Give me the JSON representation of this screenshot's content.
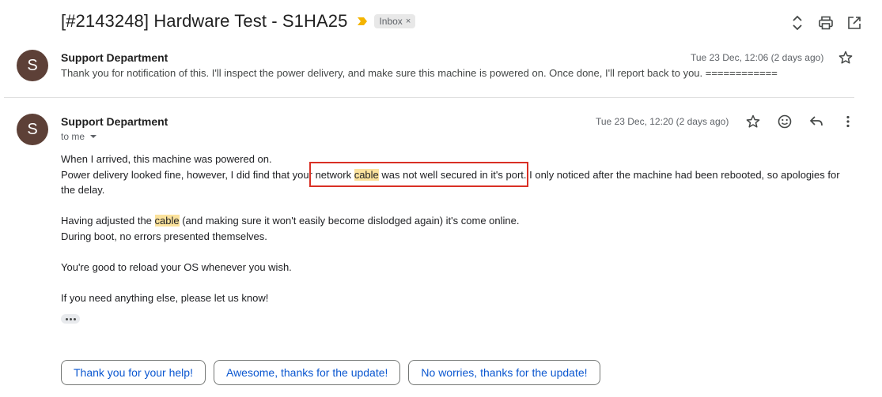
{
  "subject": "[#2143248] Hardware Test - S1HA25",
  "label": "Inbox",
  "label_remove": "×",
  "toolbar": {
    "expand_icon": "unfold-icon",
    "print_icon": "print-icon",
    "open_new_window_icon": "open-in-new-icon"
  },
  "messages": [
    {
      "avatar_letter": "S",
      "sender": "Support Department",
      "snippet": "Thank you for notification of this. I'll inspect the power delivery, and make sure this machine is powered on. Once done, I'll report back to you. ============",
      "date": "Tue 23 Dec, 12:06 (2 days ago)"
    },
    {
      "avatar_letter": "S",
      "sender": "Support Department",
      "date": "Tue 23 Dec, 12:20 (2 days ago)",
      "to": "to me",
      "body": {
        "l1": "When I arrived, this machine was powered on.",
        "l2a": "Power delivery looked fine, however, I did find that your network ",
        "l2hl": "cable",
        "l2b": " was not well secured in it's port. I only noticed after the machine had been rebooted, so apologies for the delay.",
        "l3a": "Having adjusted the ",
        "l3hl": "cable",
        "l3b": " (and making sure it won't easily become dislodged again) it's come online.",
        "l4": "During boot, no errors presented themselves.",
        "l5": "You're good to reload your OS whenever you wish.",
        "l6": "If you need anything else, please let us know!"
      }
    }
  ],
  "smart_replies": [
    "Thank you for your help!",
    "Awesome, thanks for the update!",
    "No worries, thanks for the update!"
  ],
  "colors": {
    "avatar": "#5d4037",
    "highlight": "#fbe29c",
    "annotation_box": "#d93025",
    "reply_text": "#0b57d0",
    "importance": "#f4b400"
  }
}
